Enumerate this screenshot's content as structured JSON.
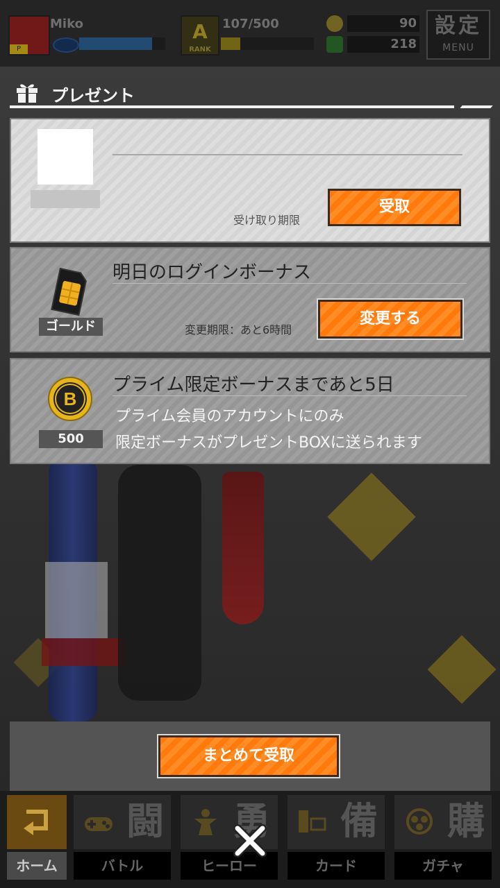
{
  "status_bar": {
    "player_name": "Miko",
    "hp_fraction": 0.85,
    "rank_letter": "A",
    "rank_label": "RANK",
    "exp_text": "107/500",
    "exp_fraction": 0.21,
    "gold_coins": "90",
    "green_gems": "218",
    "menu_kanji": "設定",
    "menu_label": "MENU"
  },
  "header": {
    "title": "プレゼント",
    "icon": "gift-icon"
  },
  "presents": [
    {
      "item_name": "",
      "deadline": "受け取り期限",
      "button": "受取"
    },
    {
      "item_label": "ゴールド",
      "item_name": "明日のログインボーナス",
      "deadline": "変更期限：あと6時間",
      "button": "変更する"
    },
    {
      "item_label": "500",
      "item_name": "プライム限定ボーナスまであと5日",
      "desc_line1": "プライム会員のアカウントにのみ",
      "desc_line2": "限定ボーナスがプレゼントBOXに送られます"
    }
  ],
  "claim_all": "まとめて受取",
  "nav": [
    {
      "label": "ホーム",
      "icon": "back-arrow-icon"
    },
    {
      "label": "バトル",
      "kanji": "闘",
      "icon": "gamepad-icon"
    },
    {
      "label": "ヒーロー",
      "kanji": "勇",
      "icon": "hero-icon"
    },
    {
      "label": "カード",
      "kanji": "備",
      "icon": "card-icon"
    },
    {
      "label": "ガチャ",
      "kanji": "購",
      "icon": "gacha-icon"
    }
  ],
  "colors": {
    "accent_orange": "#ff7a0a",
    "title_white": "#f2f2f2",
    "nav_bg": "#1c1c1c"
  }
}
